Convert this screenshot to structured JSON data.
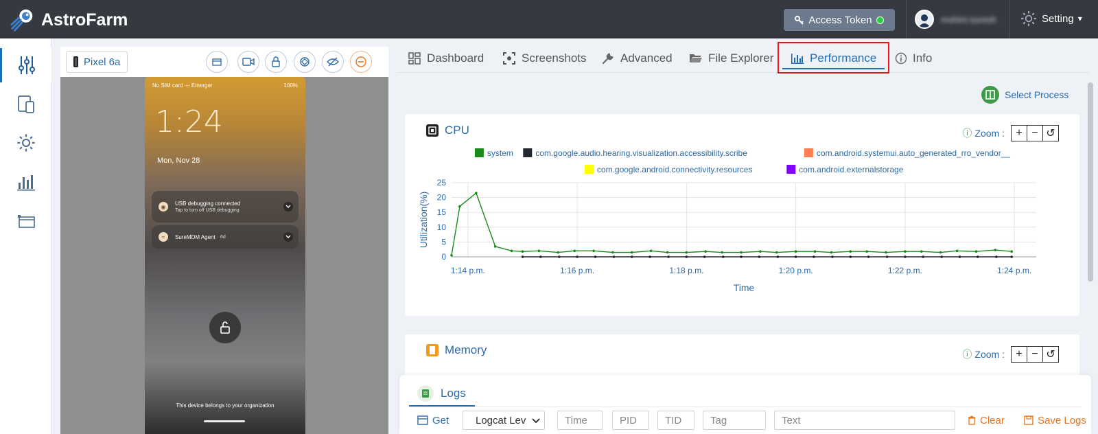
{
  "app": {
    "title": "AstroFarm"
  },
  "header": {
    "access_token_label": "Access Token",
    "user_name": "mohini.suresh",
    "setting_label": "Setting"
  },
  "sidebar": {
    "items": [
      {
        "icon": "sliders-icon",
        "active": true
      },
      {
        "icon": "devices-icon",
        "active": false
      },
      {
        "icon": "gear-icon",
        "active": false
      },
      {
        "icon": "bar-chart-icon",
        "active": false
      },
      {
        "icon": "window-icon",
        "active": false
      }
    ]
  },
  "device": {
    "name": "Pixel 6a",
    "status_left": "No SIM card — Emerger",
    "status_right": "100%",
    "clock": "1:24",
    "date": "Mon, Nov 28",
    "notifications": [
      {
        "title": "USB debugging connected",
        "subtitle": "Tap to turn off USB debugging"
      },
      {
        "title": "SureMDM Agent",
        "subtitle": "· 6d"
      }
    ],
    "footer": "This device belongs to your organization"
  },
  "tabs": [
    {
      "label": "Dashboard",
      "icon": "dashboard-icon"
    },
    {
      "label": "Screenshots",
      "icon": "screenshot-icon"
    },
    {
      "label": "Advanced",
      "icon": "wrench-icon"
    },
    {
      "label": "File Explorer",
      "icon": "folder-icon"
    },
    {
      "label": "Performance",
      "icon": "bar-chart-icon",
      "active": true
    },
    {
      "label": "Info",
      "icon": "info-icon"
    }
  ],
  "select_process_label": "Select Process",
  "cpu_card": {
    "title": "CPU",
    "zoom_label": "Zoom :"
  },
  "memory_card": {
    "title": "Memory",
    "zoom_label": "Zoom :"
  },
  "colors": {
    "accent": "#1f6fb8",
    "highlight": "#e11111",
    "system": "#1a8a1a"
  },
  "chart_data": {
    "type": "line",
    "title": "CPU",
    "xlabel": "Time",
    "ylabel": "Utilization(%)",
    "ylim": [
      0,
      25
    ],
    "yticks": [
      0,
      5,
      10,
      15,
      20,
      25
    ],
    "xticks": [
      "1:14 p.m.",
      "1:16 p.m.",
      "1:18 p.m.",
      "1:20 p.m.",
      "1:22 p.m.",
      "1:24 p.m."
    ],
    "xlim_minutes_after_1pm": [
      13.7,
      24.4
    ],
    "grid": true,
    "legend_position": "top",
    "series": [
      {
        "name": "system",
        "color": "#1a8a1a",
        "x": [
          13.7,
          13.85,
          14.15,
          14.5,
          14.8,
          15.0,
          15.3,
          15.65,
          15.95,
          16.3,
          16.65,
          17.0,
          17.35,
          17.65,
          18.0,
          18.35,
          18.65,
          19.0,
          19.35,
          19.65,
          20.0,
          20.35,
          20.65,
          21.0,
          21.3,
          21.65,
          22.0,
          22.3,
          22.65,
          22.95,
          23.3,
          23.65,
          23.95
        ],
        "values": [
          0.5,
          17,
          21.5,
          3.5,
          2,
          1.8,
          2,
          1.5,
          2,
          2,
          1.5,
          1.5,
          2,
          1.5,
          1.5,
          1.8,
          1.5,
          1.5,
          1.8,
          1.5,
          1.8,
          1.8,
          1.5,
          1.8,
          1.8,
          1.5,
          1.8,
          1.8,
          1.5,
          2,
          1.8,
          2.3,
          1.8
        ]
      },
      {
        "name": "com.google.audio.hearing.visualization.accessibility.scribe",
        "color": "#222733",
        "x": [
          15.0,
          15.33,
          15.67,
          16.0,
          16.33,
          16.67,
          17.0,
          17.33,
          17.67,
          18.0,
          18.33,
          18.67,
          19.0,
          19.33,
          19.67,
          20.0,
          20.33,
          20.67,
          21.0,
          21.33,
          21.67,
          22.0,
          22.33,
          22.67,
          23.0,
          23.33,
          23.67,
          23.95
        ],
        "values": [
          0,
          0,
          0,
          0,
          0,
          0,
          0,
          0,
          0,
          0,
          0,
          0,
          0,
          0,
          0,
          0,
          0,
          0,
          0,
          0,
          0,
          0,
          0,
          0,
          0,
          0,
          0,
          0
        ]
      },
      {
        "name": "com.android.systemui.auto_generated_rro_vendor__",
        "color": "#ff7f50",
        "x": [],
        "values": []
      },
      {
        "name": "com.google.android.connectivity.resources",
        "color": "#ffff00",
        "x": [],
        "values": []
      },
      {
        "name": "com.android.externalstorage",
        "color": "#7f00ff",
        "x": [],
        "values": []
      }
    ]
  },
  "logs": {
    "tab_label": "Logs",
    "get_label": "Get",
    "logcat_level": "Logcat Lev",
    "time_placeholder": "Time",
    "pid_placeholder": "PID",
    "tid_placeholder": "TID",
    "tag_placeholder": "Tag",
    "text_placeholder": "Text",
    "clear_label": "Clear",
    "save_label": "Save Logs"
  }
}
